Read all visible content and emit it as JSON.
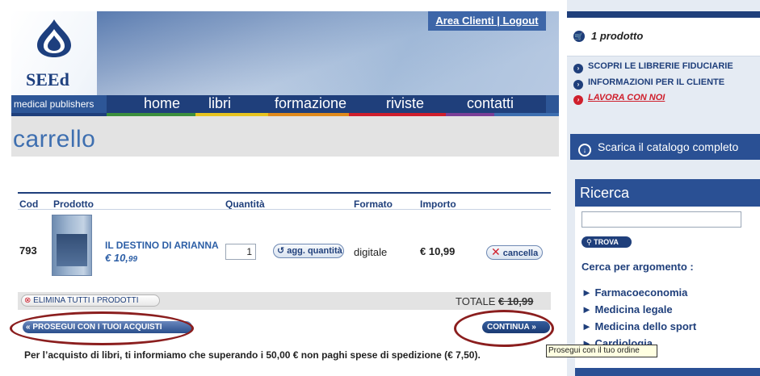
{
  "header": {
    "account_links": "Area Clienti | Logout",
    "logo_text": "SEEd",
    "tagline": "medical publishers",
    "nav": [
      "home",
      "libri",
      "formazione",
      "riviste",
      "contatti"
    ],
    "color_bar": [
      "#1f3f7b",
      "#3d8f3d",
      "#e7c31f",
      "#e08a1c",
      "#cf1f2c",
      "#7a3f97",
      "#3e6fb0"
    ]
  },
  "page": {
    "title": "carrello"
  },
  "cart": {
    "columns": {
      "cod": "Cod",
      "product": "Prodotto",
      "quantity": "Quantità",
      "format": "Formato",
      "amount": "Importo"
    },
    "items": [
      {
        "cod": "793",
        "name": "IL DESTINO DI ARIANNA",
        "price_main": "€ 10,",
        "price_cents": "99",
        "quantity": "1",
        "update_label": "agg. quantità",
        "format": "digitale",
        "amount": "€ 10,99",
        "remove_label": "cancella"
      }
    ],
    "clear_all_label": "ELIMINA TUTTI I PRODOTTI",
    "total_label": "TOTALE",
    "total_value": "€ 10,99",
    "continue_shopping_label": "PROSEGUI CON I TUOI ACQUISTI",
    "continue_label": "CONTINUA",
    "continue_arrows": "»",
    "info": "Per l’acquisto di libri, ti informiamo che superando i 50,00 € non paghi spese di spedizione (€ 7,50).",
    "tooltip": "Prosegui con il tuo ordine"
  },
  "sidebar": {
    "cart_count": "1 prodotto",
    "links": [
      "SCOPRI LE LIBRERIE FIDUCIARIE",
      "INFORMAZIONI PER IL CLIENTE",
      "LAVORA CON NOI"
    ],
    "catalog_button": "Scarica il catalogo completo",
    "search_title": "Ricerca",
    "search_button": "TROVA",
    "topics_title": "Cerca per argomento :",
    "topics": [
      "Farmacoeconomia",
      "Medicina legale",
      "Medicina dello sport",
      "Cardiologia"
    ]
  }
}
